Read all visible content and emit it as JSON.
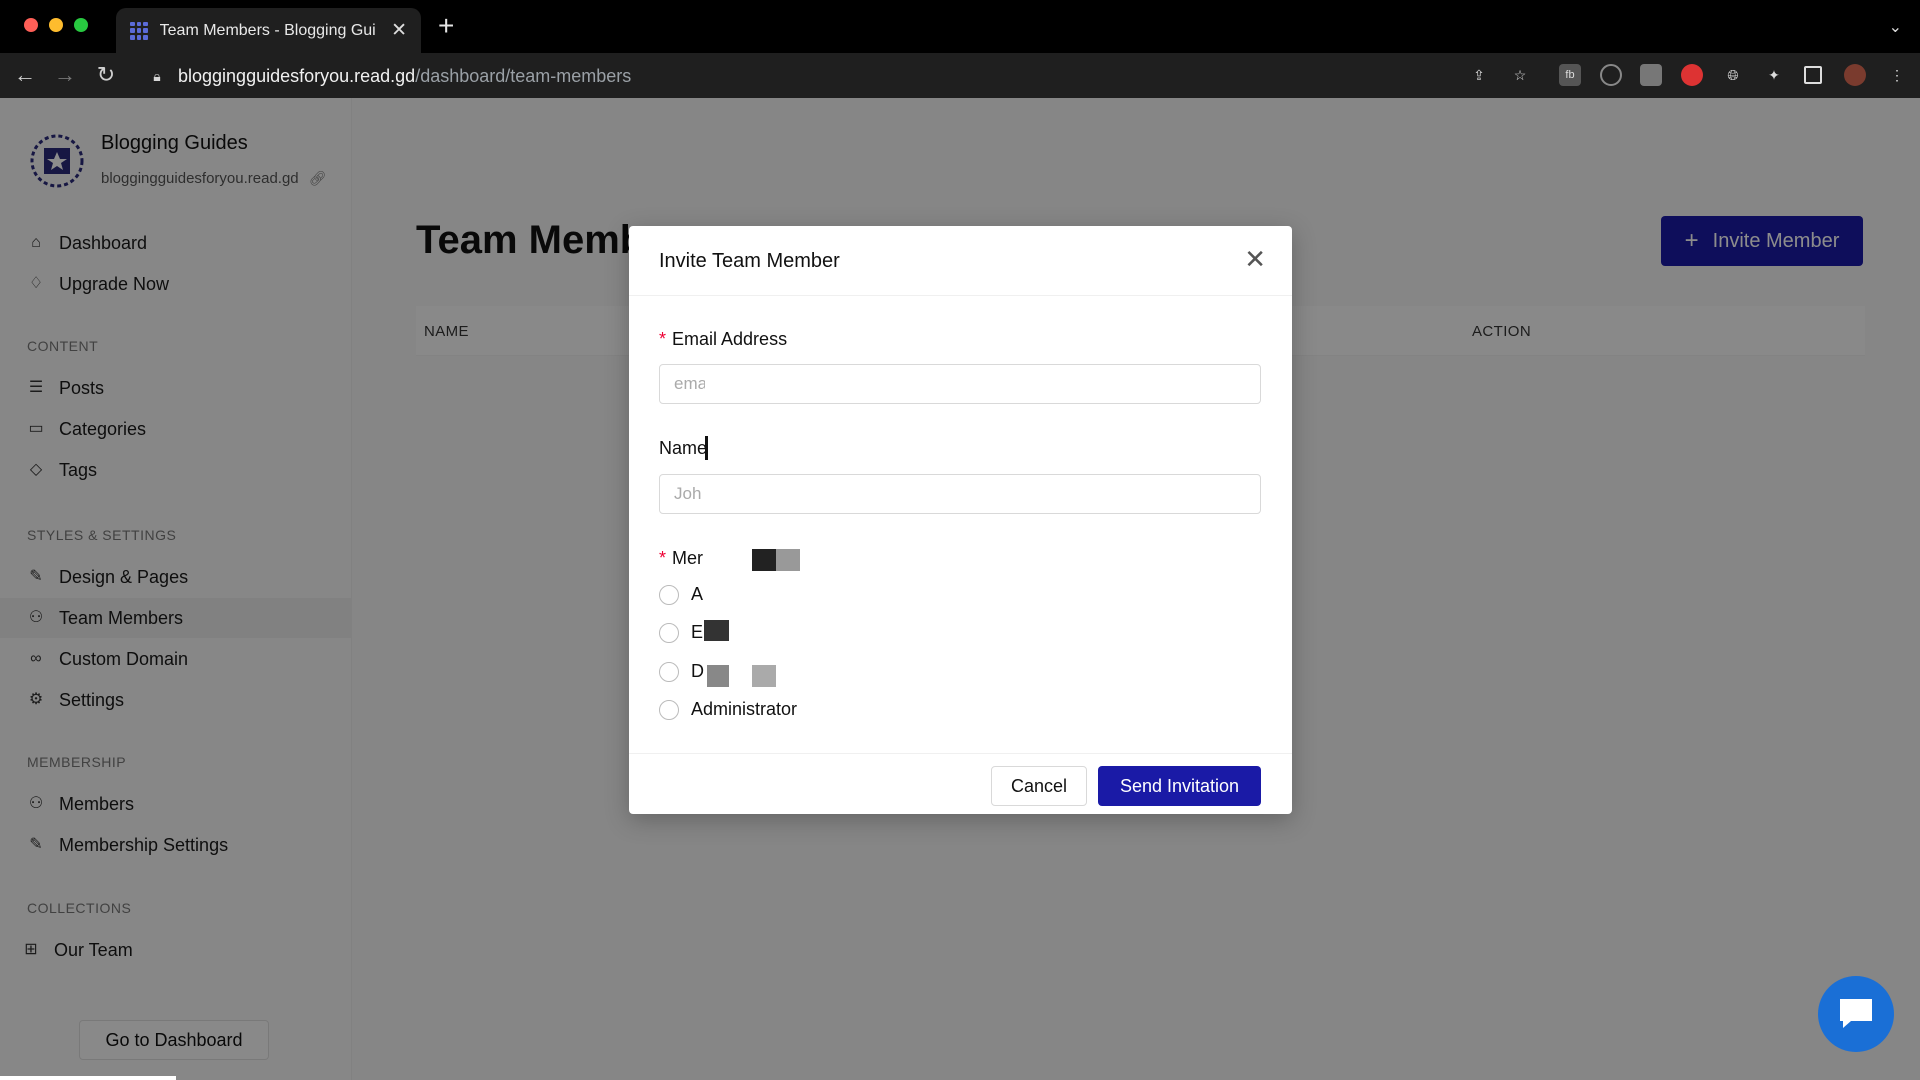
{
  "browser": {
    "tab_title": "Team Members - Blogging Gui",
    "url_host": "bloggingguidesforyou.read.gd",
    "url_path": "/dashboard/team-members"
  },
  "sidebar": {
    "brand_name": "Blogging Guides",
    "brand_url": "bloggingguidesforyou.read.gd",
    "top_items": [
      {
        "label": "Dashboard",
        "icon": "home-icon"
      },
      {
        "label": "Upgrade Now",
        "icon": "rocket-icon"
      }
    ],
    "content_label": "CONTENT",
    "content_items": [
      {
        "label": "Posts",
        "icon": "list-icon"
      },
      {
        "label": "Categories",
        "icon": "folder-icon"
      },
      {
        "label": "Tags",
        "icon": "tag-icon"
      }
    ],
    "styles_label": "STYLES & SETTINGS",
    "styles_items": [
      {
        "label": "Design & Pages",
        "icon": "edit-icon"
      },
      {
        "label": "Team Members",
        "icon": "user-icon"
      },
      {
        "label": "Custom Domain",
        "icon": "link-icon"
      },
      {
        "label": "Settings",
        "icon": "gear-icon"
      }
    ],
    "membership_label": "MEMBERSHIP",
    "membership_items": [
      {
        "label": "Members",
        "icon": "user-icon"
      },
      {
        "label": "Membership Settings",
        "icon": "edit-icon"
      }
    ],
    "collections_label": "COLLECTIONS",
    "collections_items": [
      {
        "label": "Our Team",
        "icon": "grid-icon"
      }
    ],
    "go_dashboard": "Go to Dashboard"
  },
  "main": {
    "title": "Team Memb",
    "invite_button": "Invite Member",
    "col_name": "NAME",
    "col_action": "ACTION"
  },
  "modal": {
    "title": "Invite Team Member",
    "email_label": "Email Address",
    "email_placeholder": "ema",
    "name_label": "Name",
    "name_placeholder": "Joh",
    "role_label": "Mer",
    "roles": [
      "A",
      "E",
      "D",
      "Administrator"
    ],
    "cancel": "Cancel",
    "send": "Send Invitation"
  },
  "colors": {
    "accent": "#1a1aa6",
    "chat": "#1a6fd6"
  }
}
